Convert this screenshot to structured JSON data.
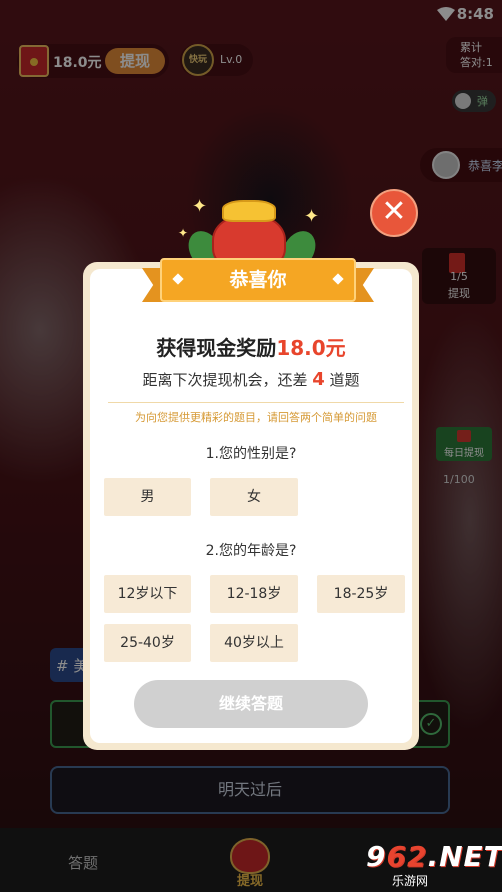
{
  "status_bar": {
    "time": "8:48"
  },
  "top_bar": {
    "cash_amount": "18.0元",
    "withdraw_label": "提现",
    "level_logo": "快玩",
    "level": "Lv.0",
    "stats_line1": "累计",
    "stats_line2": "答对:1"
  },
  "side": {
    "toggle_label": "弹",
    "ticker_text": "恭喜李",
    "task_progress": "1/5",
    "task_withdraw": "提现",
    "daily_withdraw": "每日提现",
    "daily_count": "1/100"
  },
  "background": {
    "tag_label": "# 美",
    "tomorrow_label": "明天过后",
    "check_mark": "✓"
  },
  "bottom_nav": {
    "answer_label": "答题",
    "withdraw_label": "提现"
  },
  "watermark": {
    "big_prefix": "9",
    "big_red": "62",
    "big_suffix": ".NET",
    "small": "乐游网"
  },
  "modal": {
    "close_symbol": "✕",
    "ribbon_title": "恭喜你",
    "reward_prefix": "获得现金奖励",
    "reward_amount": "18.0元",
    "next_prefix": "距离下次提现机会，还差 ",
    "next_number": "4",
    "next_suffix": " 道题",
    "hint": "为向您提供更精彩的题目，请回答两个简单的问题",
    "q1": {
      "label": "1.您的性别是?",
      "options": [
        "男",
        "女"
      ]
    },
    "q2": {
      "label": "2.您的年龄是?",
      "options": [
        "12岁以下",
        "12-18岁",
        "18-25岁",
        "25-40岁",
        "40岁以上"
      ]
    },
    "continue_label": "继续答题"
  },
  "colors": {
    "accent_orange": "#f5a623",
    "highlight_red": "#e8452c",
    "option_bg": "#f7ead6",
    "disabled_button": "#d0d0d0"
  }
}
